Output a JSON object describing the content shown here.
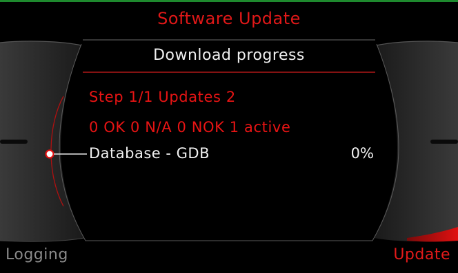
{
  "header": {
    "title": "Software Update",
    "subtitle": "Download progress"
  },
  "status": {
    "step_line": "Step 1/1 Updates 2",
    "summary_line": "0 OK 0 N/A 0 NOK 1 active"
  },
  "items": [
    {
      "name": "Database - GDB",
      "progress": "0%"
    }
  ],
  "softkeys": {
    "left": "Logging",
    "right": "Update"
  },
  "colors": {
    "accent_red": "#e81414",
    "text_white": "#f2f2f2",
    "softkey_grey": "#8a8a8a",
    "top_line_green": "#1e8a2e",
    "background": "#000000"
  },
  "icons": {
    "selector": "radio-selector-icon"
  }
}
